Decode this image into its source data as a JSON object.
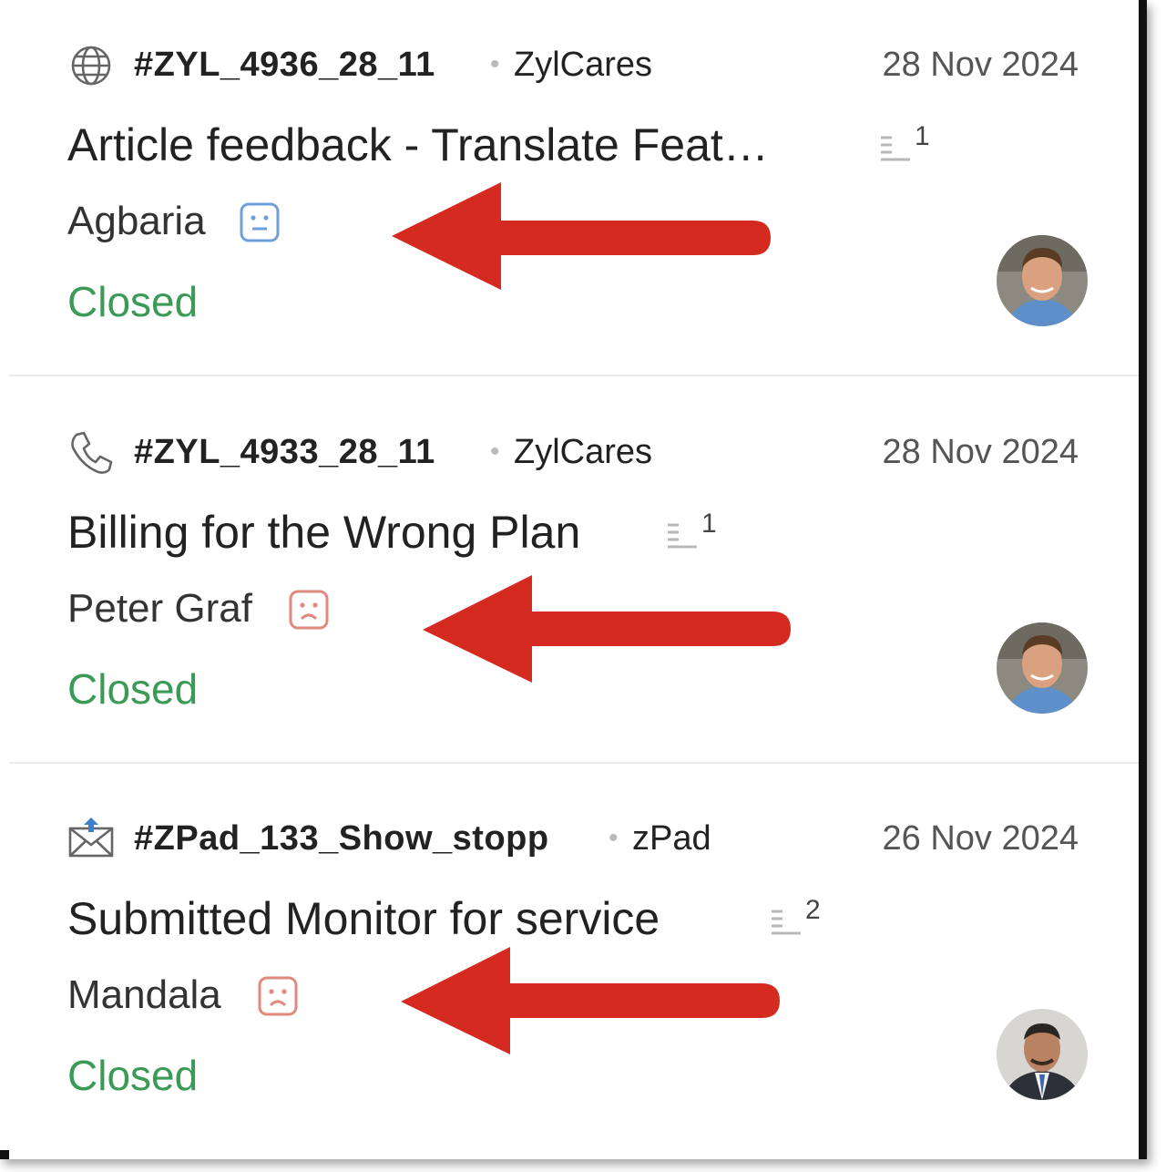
{
  "colors": {
    "status_closed": "#3a9a56",
    "arrow_red": "#d42a20",
    "neutral_face": "#6f9fd8",
    "sad_face": "#e0897c"
  },
  "tickets": [
    {
      "channel_icon": "globe-icon",
      "id": "#ZYL_4936_28_11",
      "department": "ZylCares",
      "date": "28 Nov 2024",
      "subject": "Article feedback - Translate Feat…",
      "thread_count": "1",
      "contact": "Agbaria",
      "sentiment": "neutral-face-icon",
      "status": "Closed",
      "avatar": "agent-avatar"
    },
    {
      "channel_icon": "phone-icon",
      "id": "#ZYL_4933_28_11",
      "department": "ZylCares",
      "date": "28 Nov 2024",
      "subject": "Billing for the Wrong Plan",
      "thread_count": "1",
      "contact": "Peter Graf",
      "sentiment": "sad-face-icon",
      "status": "Closed",
      "avatar": "agent-avatar"
    },
    {
      "channel_icon": "email-icon",
      "id": "#ZPad_133_Show_stopp",
      "department": "zPad",
      "date": "26 Nov 2024",
      "subject": "Submitted Monitor for service",
      "thread_count": "2",
      "contact": "Mandala",
      "sentiment": "sad-face-icon",
      "status": "Closed",
      "avatar": "agent-avatar"
    }
  ]
}
